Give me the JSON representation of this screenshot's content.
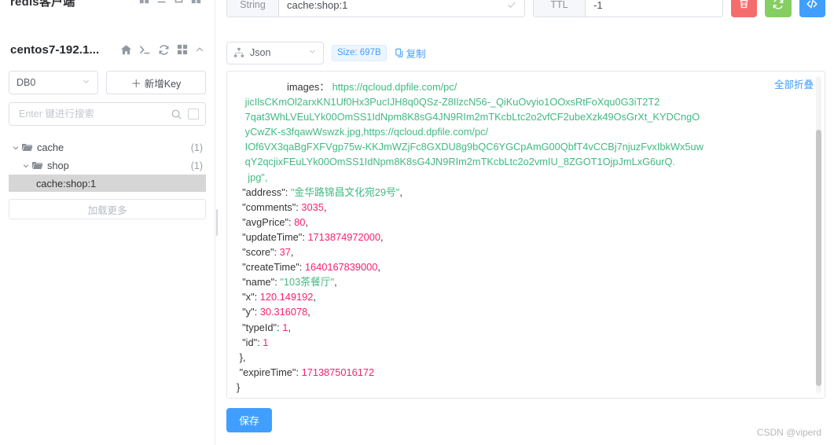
{
  "sidebar": {
    "clipped_title": "redis客户端",
    "connection_name": "centos7-192.1...",
    "header_icons": [
      "home-icon",
      "terminal-icon",
      "refresh-icon",
      "grid-icon",
      "collapse-chevron-icon"
    ],
    "db_select": {
      "value": "DB0"
    },
    "add_key_button": {
      "plus": "＋",
      "label": "新增Key"
    },
    "search": {
      "value": "",
      "placeholder": "Enter 键进行搜索"
    },
    "tree": [
      {
        "label": "cache",
        "count": "(1)",
        "type": "folder",
        "level": 1,
        "expanded": true
      },
      {
        "label": "shop",
        "count": "(1)",
        "type": "folder",
        "level": 2,
        "expanded": true
      },
      {
        "label": "cache:shop:1",
        "count": "",
        "type": "key",
        "level": 3,
        "selected": true
      }
    ],
    "load_more": "加载更多"
  },
  "main": {
    "key_row": {
      "type_label": "String",
      "key_value": "cache:shop:1",
      "ttl_label": "TTL",
      "ttl_value": "-1"
    },
    "action_buttons": [
      {
        "name": "delete-key-button",
        "icon": "trash-icon",
        "color": "#f56c6c"
      },
      {
        "name": "refresh-key-button",
        "icon": "refresh-icon",
        "color": "#85ce61"
      },
      {
        "name": "code-view-button",
        "icon": "code-icon",
        "color": "#409eff"
      }
    ],
    "viewbar": {
      "format_select": "Json",
      "size_tag": "Size: 697B",
      "copy_label": "复制"
    },
    "json_panel": {
      "collapse_all": "全部折叠",
      "images_key": "images：",
      "images_value_lines": [
        "https://qcloud.dpfile.com/pc/",
        "jicIlsCKmOl2arxKN1Uf0Hx3PucIJH8q0QSz-Z8IlzcN56-_QiKuOvyio1OOxsRtFoXqu0G3iT2T2",
        "7qat3WhLVEuLYk00OmSS1IdNpm8K8sG4JN9RIm2mTKcbLtc2o2vfCF2ubeXzk49OsGrXt_KYDCngO",
        "yCwZK-s3fqawWswzk.jpg,https://qcloud.dpfile.com/pc/",
        "IOf6VX3qaBgFXFVgp75w-KKJmWZjFc8GXDU8g9bQC6YGCpAmG00QbfT4vCCBj7njuzFvxIbkWx5uw",
        "qY2qcjixFEuLYk00OmSS1IdNpm8K8sG4JN9RIm2mTKcbLtc2o2vmIU_8ZGOT1OjpJmLxG6urQ."
      ],
      "images_value_tail": "jpg\",",
      "fields": [
        {
          "key": "\"address\":",
          "value": "\"金华路锦昌文化宛29号\"",
          "kind": "string",
          "comma": ","
        },
        {
          "key": "\"comments\":",
          "value": "3035",
          "kind": "number",
          "comma": ","
        },
        {
          "key": "\"avgPrice\":",
          "value": "80",
          "kind": "number",
          "comma": ","
        },
        {
          "key": "\"updateTime\":",
          "value": "1713874972000",
          "kind": "number",
          "comma": ","
        },
        {
          "key": "\"score\":",
          "value": "37",
          "kind": "number",
          "comma": ","
        },
        {
          "key": "\"createTime\":",
          "value": "1640167839000",
          "kind": "number",
          "comma": ","
        },
        {
          "key": "\"name\":",
          "value": "\"103茶餐厅\"",
          "kind": "string",
          "comma": ","
        },
        {
          "key": "\"x\":",
          "value": "120.149192",
          "kind": "number",
          "comma": ","
        },
        {
          "key": "\"y\":",
          "value": "30.316078",
          "kind": "number",
          "comma": ","
        },
        {
          "key": "\"typeId\":",
          "value": "1",
          "kind": "number",
          "comma": ","
        },
        {
          "key": "\"id\":",
          "value": "1",
          "kind": "number",
          "comma": ""
        }
      ],
      "close_brace_inner": "},",
      "expire_key": "\"expireTime\":",
      "expire_value": "1713875016172",
      "close_brace_outer": "}"
    },
    "save_button": "保存",
    "watermark": "CSDN @viperd"
  }
}
